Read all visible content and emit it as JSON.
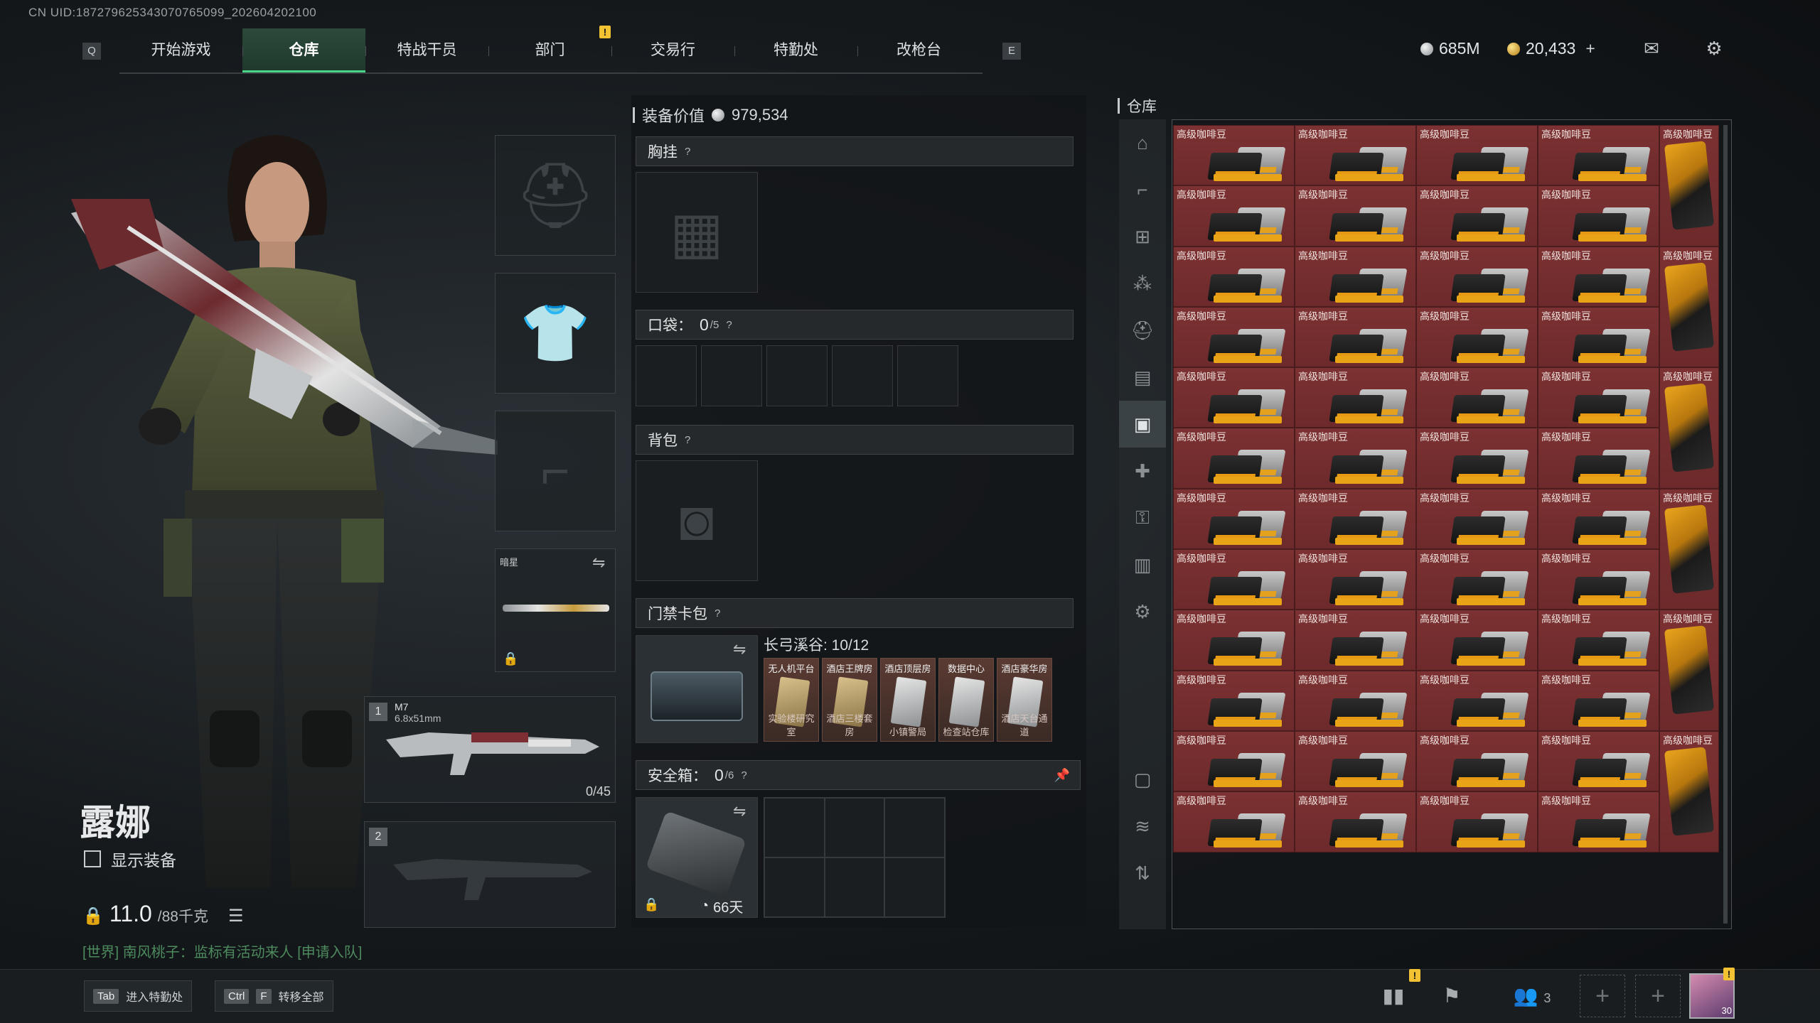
{
  "uid": "CN UID:1872796253430707650​99_202604202100",
  "nav": {
    "left_key": "Q",
    "right_key": "E",
    "tabs": [
      {
        "label": "开始游戏"
      },
      {
        "label": "仓库"
      },
      {
        "label": "特战干员"
      },
      {
        "label": "部门"
      },
      {
        "label": "交易行"
      },
      {
        "label": "特勤处"
      },
      {
        "label": "改枪台"
      }
    ],
    "alert": "!"
  },
  "currency": {
    "silver": "685M",
    "gold": "20,433",
    "plus": "+"
  },
  "character": {
    "name": "露娜",
    "show_equipment": "显示装备",
    "weight": "11.0",
    "weight_max": "/88千克",
    "world_chat": "[世界] 南风桃子：监标有活动来人 [申请入队]"
  },
  "weapons": {
    "melee_label": "暗星",
    "primary": {
      "slot": "1",
      "name": "M7",
      "caliber": "6.8x51mm",
      "ammo": "0/45"
    },
    "secondary": {
      "slot": "2"
    }
  },
  "equipment": {
    "value_label": "装备价值",
    "value": "979,534",
    "chest_rig": "胸挂",
    "pockets": "口袋：",
    "pockets_count": "0",
    "pockets_max": "/5",
    "backpack": "背包",
    "keycard": "门禁卡包",
    "keycard_map": "长弓溪谷: 10/12",
    "cards": [
      {
        "top": "无人机平台",
        "bottom": "实验楼研究室"
      },
      {
        "top": "酒店王牌房",
        "bottom": "酒店三楼套房"
      },
      {
        "top": "酒店顶层房",
        "bottom": "小镇警局"
      },
      {
        "top": "数据中心",
        "bottom": "检查站仓库"
      },
      {
        "top": "酒店豪华房",
        "bottom": "酒店天台通道"
      }
    ],
    "safe_box": "安全箱：",
    "safe_count": "0",
    "safe_max": "/6",
    "safe_days": "66天"
  },
  "warehouse": {
    "title": "仓库",
    "item_name": "高级咖啡豆"
  },
  "bottom": {
    "tab_key": "Tab",
    "tab_action": "进入特勤处",
    "ctrl_key": "Ctrl",
    "f_key": "F",
    "transfer_action": "转移全部",
    "friends": "3",
    "avatar_badge": "30"
  }
}
